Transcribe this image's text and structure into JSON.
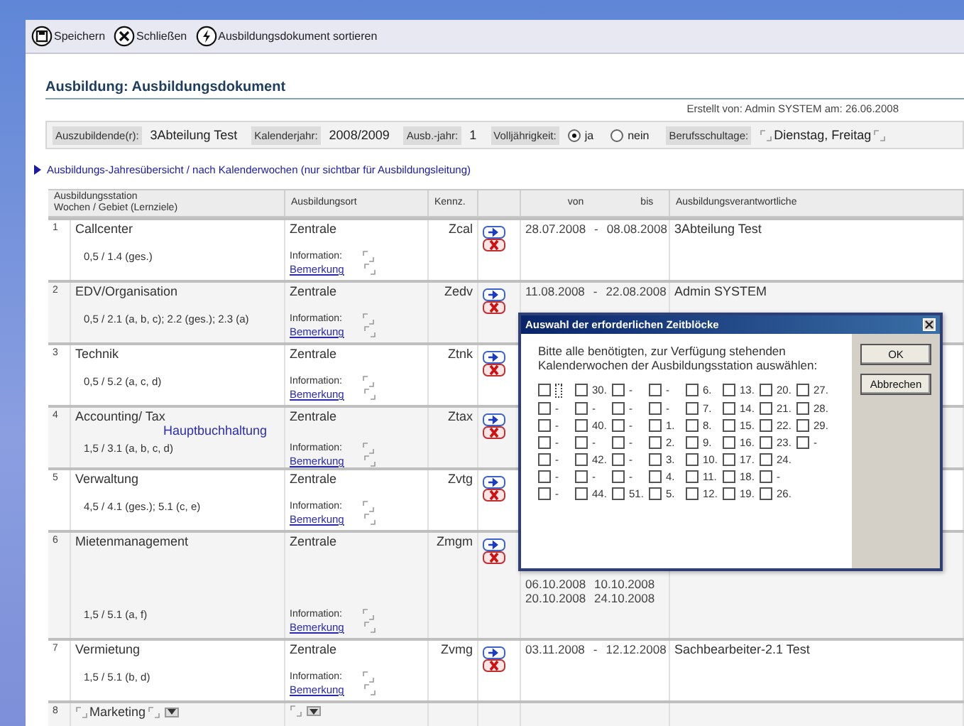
{
  "toolbar": [
    {
      "kind": "save",
      "label": "Speichern"
    },
    {
      "kind": "close",
      "label": "Schließen"
    },
    {
      "kind": "sort",
      "label": "Ausbildungsdokument sortieren"
    }
  ],
  "title": "Ausbildung: Ausbildungsdokument",
  "created": "Erstellt von: Admin SYSTEM  am: 26.06.2008",
  "fields": [
    {
      "kind": "text",
      "label": "Auszubildende(r):",
      "value": "3Abteilung Test"
    },
    {
      "kind": "text",
      "label": "Kalenderjahr:",
      "value": "2008/2009"
    },
    {
      "kind": "text",
      "label": "Ausb.-jahr:",
      "value": "1"
    },
    {
      "kind": "radio",
      "label": "Volljährigkeit:",
      "options": [
        {
          "label": "ja",
          "selected": true
        },
        {
          "label": "nein",
          "selected": false
        }
      ]
    },
    {
      "kind": "edit",
      "label": "Berufsschultage:",
      "value": "Dienstag, Freitag"
    }
  ],
  "section_link": "Ausbildungs-Jahresübersicht / nach Kalenderwochen (nur sichtbar für Ausbildungsleitung)",
  "table": {
    "columns": {
      "station": "Ausbildungsstation",
      "weeks": "Wochen / Gebiet (Lernziele)",
      "ort": "Ausbildungsort",
      "kennz": "Kennz.",
      "von": "von",
      "bis": "bis",
      "verantw": "Ausbildungsverantwortliche"
    },
    "rows": [
      {
        "kind": "entry",
        "number": "1",
        "station": "Callcenter",
        "weeks": "0,5  /  1.4 (ges.)",
        "ort": "Zentrale",
        "kennz": "Zcal",
        "info_label": "Information:",
        "note_link": "Bemerkung",
        "periods": [
          {
            "von": "28.07.2008",
            "sep": "-",
            "bis": "08.08.2008"
          }
        ],
        "verantw": "3Abteilung Test"
      },
      {
        "kind": "entry",
        "number": "2",
        "station": "EDV/Organisation",
        "weeks": "0,5  /  2.1 (a, b, c); 2.2 (ges.); 2.3 (a)",
        "ort": "Zentrale",
        "kennz": "Zedv",
        "info_label": "Information:",
        "note_link": "Bemerkung",
        "periods": [
          {
            "von": "11.08.2008",
            "sep": "-",
            "bis": "22.08.2008"
          }
        ],
        "verantw": "Admin SYSTEM"
      },
      {
        "kind": "entry",
        "number": "3",
        "station": "Technik",
        "weeks": "0,5  /  5.2 (a, c, d)",
        "ort": "Zentrale",
        "kennz": "Ztnk",
        "info_label": "Information:",
        "note_link": "Bemerkung"
      },
      {
        "kind": "entry",
        "number": "4",
        "station": "Accounting/ Tax",
        "sub": "Hauptbuchhaltung",
        "weeks": "1,5  /  3.1 (a, b, c, d)",
        "ort": "Zentrale",
        "kennz": "Ztax",
        "info_label": "Information:",
        "note_link": "Bemerkung"
      },
      {
        "kind": "entry",
        "number": "5",
        "station": "Verwaltung",
        "weeks": "4,5  /  4.1 (ges.); 5.1 (c, e)",
        "ort": "Zentrale",
        "kennz": "Zvtg",
        "info_label": "Information:",
        "note_link": "Bemerkung"
      },
      {
        "kind": "entry",
        "number": "6",
        "station": "Mietenmanagement",
        "weeks": "1,5  /  5.1 (a, f)",
        "ort": "Zentrale",
        "kennz": "Zmgm",
        "info_label": "Information:",
        "note_link": "Bemerkung",
        "periods": [
          {
            "von": "06.10.2008",
            "bis": "10.10.2008"
          },
          {
            "von": "20.10.2008",
            "bis": "24.10.2008"
          }
        ]
      },
      {
        "kind": "entry",
        "number": "7",
        "station": "Vermietung",
        "weeks": "1,5  /  5.1 (b, d)",
        "ort": "Zentrale",
        "kennz": "Zvmg",
        "info_label": "Information:",
        "note_link": "Bemerkung",
        "periods": [
          {
            "von": "03.11.2008",
            "sep": "-",
            "bis": "12.12.2008"
          }
        ],
        "verantw": "Sachbearbeiter-2.1 Test"
      },
      {
        "kind": "new",
        "number": "8",
        "station": "Marketing"
      }
    ]
  },
  "dialog": {
    "title": "Auswahl der erforderlichen Zeitblöcke",
    "text": "Bitte alle benötigten, zur Verfügung stehenden Kalenderwochen der Ausbildungsstation auswählen:",
    "weeks": [
      [
        {
          "checked": false,
          "focused": true
        },
        {
          "label": "30.",
          "checked": false
        },
        {
          "label": "-",
          "checked": false
        },
        {
          "label": "-",
          "checked": false
        },
        {
          "label": "6.",
          "checked": false
        },
        {
          "label": "13.",
          "checked": false
        },
        {
          "label": "20.",
          "checked": false
        },
        {
          "label": "27.",
          "checked": false
        }
      ],
      [
        {
          "label": "-",
          "checked": false
        },
        {
          "label": "-",
          "checked": false
        },
        {
          "label": "-",
          "checked": false
        },
        {
          "label": "-",
          "checked": false
        },
        {
          "label": "7.",
          "checked": false
        },
        {
          "label": "14.",
          "checked": false
        },
        {
          "label": "21.",
          "checked": false
        },
        {
          "label": "28.",
          "checked": false
        }
      ],
      [
        {
          "label": "-",
          "checked": false
        },
        {
          "label": "40.",
          "checked": false
        },
        {
          "label": "-",
          "checked": false
        },
        {
          "label": "1.",
          "checked": false
        },
        {
          "label": "8.",
          "checked": false
        },
        {
          "label": "15.",
          "checked": false
        },
        {
          "label": "22.",
          "checked": false
        },
        {
          "label": "29.",
          "checked": false
        }
      ],
      [
        {
          "label": "-",
          "checked": false
        },
        {
          "label": "-",
          "checked": false
        },
        {
          "label": "-",
          "checked": false
        },
        {
          "label": "2.",
          "checked": false
        },
        {
          "label": "9.",
          "checked": false
        },
        {
          "label": "16.",
          "checked": false
        },
        {
          "label": "23.",
          "checked": false
        },
        {
          "label": "-",
          "checked": false
        }
      ],
      [
        {
          "label": "-",
          "checked": false
        },
        {
          "label": "42.",
          "checked": false
        },
        {
          "label": "-",
          "checked": false
        },
        {
          "label": "3.",
          "checked": false
        },
        {
          "label": "10.",
          "checked": false
        },
        {
          "label": "17.",
          "checked": false
        },
        {
          "label": "24.",
          "checked": false
        }
      ],
      [
        {
          "label": "-",
          "checked": false
        },
        {
          "label": "-",
          "checked": false
        },
        {
          "label": "-",
          "checked": false
        },
        {
          "label": "4.",
          "checked": false
        },
        {
          "label": "11.",
          "checked": false
        },
        {
          "label": "18.",
          "checked": false
        },
        {
          "label": "-",
          "checked": false
        }
      ],
      [
        {
          "label": "-",
          "checked": false
        },
        {
          "label": "44.",
          "checked": false
        },
        {
          "label": "51.",
          "checked": false
        },
        {
          "label": "5.",
          "checked": false
        },
        {
          "label": "12.",
          "checked": false
        },
        {
          "label": "19.",
          "checked": false
        },
        {
          "label": "26.",
          "checked": false
        }
      ]
    ],
    "buttons": [
      "OK",
      "Abbrechen"
    ]
  }
}
